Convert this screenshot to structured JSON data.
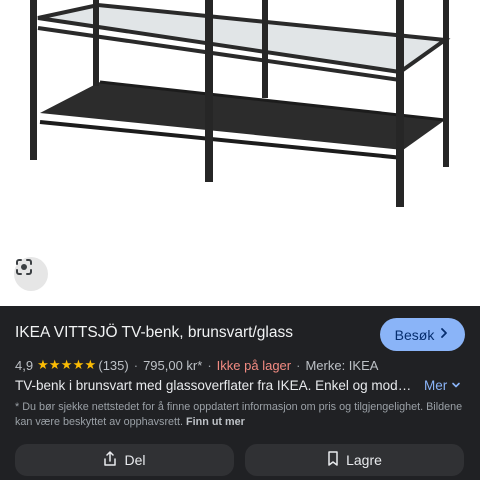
{
  "product": {
    "title": "IKEA VITTSJÖ TV-benk, brunsvart/glass",
    "visit_label": "Besøk",
    "rating": "4,9",
    "stars": "★★★★★",
    "review_count": "(135)",
    "price": "795,00 kr*",
    "stock_status": "Ikke på lager",
    "brand": "Merke: IKEA",
    "description": "TV-benk i brunsvart med glassoverflater fra IKEA. Enkel og moderne design som passer godt i stuen.",
    "more_label": "Mer",
    "disclaimer": "* Du bør sjekke nettstedet for å finne oppdatert informasjon om pris og tilgjengelighet. Bildene kan være beskyttet av opphavsrett.",
    "disclaimer_link": "Finn ut mer"
  },
  "actions": {
    "share_label": "Del",
    "save_label": "Lagre"
  },
  "icons": {
    "lens": "google-lens-icon",
    "visit_chevron": "chevron-right-icon",
    "more_chevron": "chevron-down-icon",
    "share": "share-icon",
    "save": "bookmark-icon"
  },
  "colors": {
    "panel_bg": "#202124",
    "accent": "#8ab4f8",
    "stars": "#fbbc04",
    "out_of_stock": "#f28b82",
    "button_bg": "#303134"
  }
}
